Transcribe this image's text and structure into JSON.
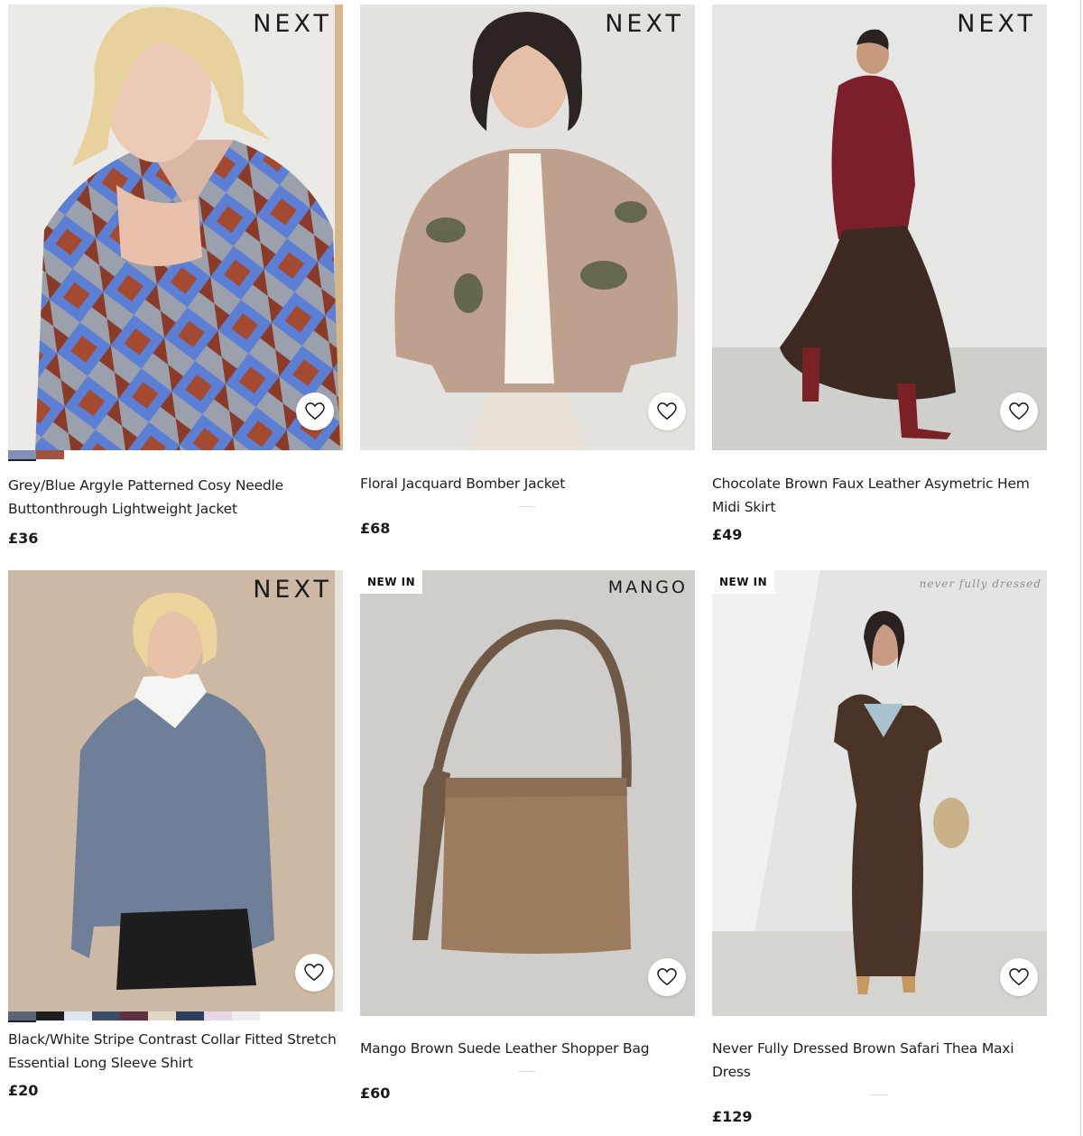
{
  "products": [
    {
      "brand": "NEXT",
      "badge": "",
      "title": "Grey/Blue Argyle Patterned Cosy Needle Buttonthrough Lightweight Jacket",
      "price": "£36",
      "swatches": [
        "#7f8fb5",
        "#a0523f"
      ]
    },
    {
      "brand": "NEXT",
      "badge": "",
      "title": "Floral Jacquard Bomber Jacket",
      "price": "£68",
      "swatches": []
    },
    {
      "brand": "NEXT",
      "badge": "",
      "title": "Chocolate Brown Faux Leather Asymetric Hem Midi Skirt",
      "price": "£49",
      "swatches": []
    },
    {
      "brand": "NEXT",
      "badge": "",
      "title": "Black/White Stripe Contrast Collar Fitted Stretch Essential Long Sleeve Shirt",
      "price": "£20",
      "swatches": [
        "#5a6475",
        "#1d1d1d",
        "#dfe6ef",
        "#3b4d66",
        "#5e2f3c",
        "#e2d8c8",
        "#2b4058",
        "#e6d6e6",
        "#eeeeee"
      ]
    },
    {
      "brand": "MANGO",
      "badge": "NEW IN",
      "title": "Mango Brown Suede Leather Shopper Bag",
      "price": "£60",
      "swatches": []
    },
    {
      "brand": "never fully dressed",
      "badge": "NEW IN",
      "title": "Never Fully Dressed Brown Safari Thea Maxi Dress",
      "price": "£129",
      "swatches": []
    }
  ],
  "icons": {
    "favourite": "heart-outline-icon"
  },
  "colors": {
    "text": "#1e1e1e",
    "badge_bg": "#ffffff",
    "page_bg": "#ffffff"
  }
}
